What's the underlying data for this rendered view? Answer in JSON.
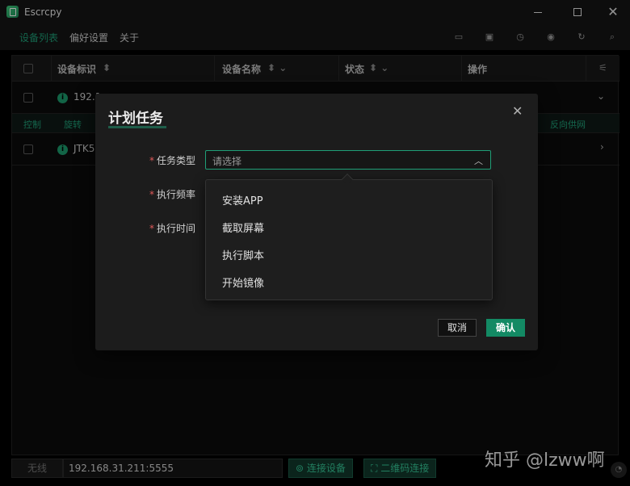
{
  "window": {
    "title": "Escrcpy"
  },
  "menu": {
    "items": [
      "设备列表",
      "偏好设置",
      "关于"
    ]
  },
  "toolbar_icons": [
    "monitor-icon",
    "cast-icon",
    "clock-icon",
    "eye-icon",
    "refresh-icon",
    "search-icon"
  ],
  "table": {
    "headers": [
      "设备标识",
      "设备名称",
      "状态",
      "操作"
    ],
    "rows": [
      {
        "id": "192.1",
        "expand": "⌄"
      },
      {
        "id": "JTK5",
        "expand": "›"
      }
    ],
    "subbar": {
      "left1": "控制",
      "left2": "旋转",
      "right": "反向供网"
    }
  },
  "bottom": {
    "status_label": "无线",
    "address": "192.168.31.211:5555",
    "connect_btn": "连接设备",
    "qr_btn": "二维码连接"
  },
  "watermark": "知乎 @lzww啊",
  "dialog": {
    "title": "计划任务",
    "labels": {
      "task_type": "任务类型",
      "frequency": "执行频率",
      "time": "执行时间"
    },
    "select_placeholder": "请选择",
    "options": [
      "安装APP",
      "截取屏幕",
      "执行脚本",
      "开始镜像"
    ],
    "cancel": "取消",
    "confirm": "确认"
  }
}
